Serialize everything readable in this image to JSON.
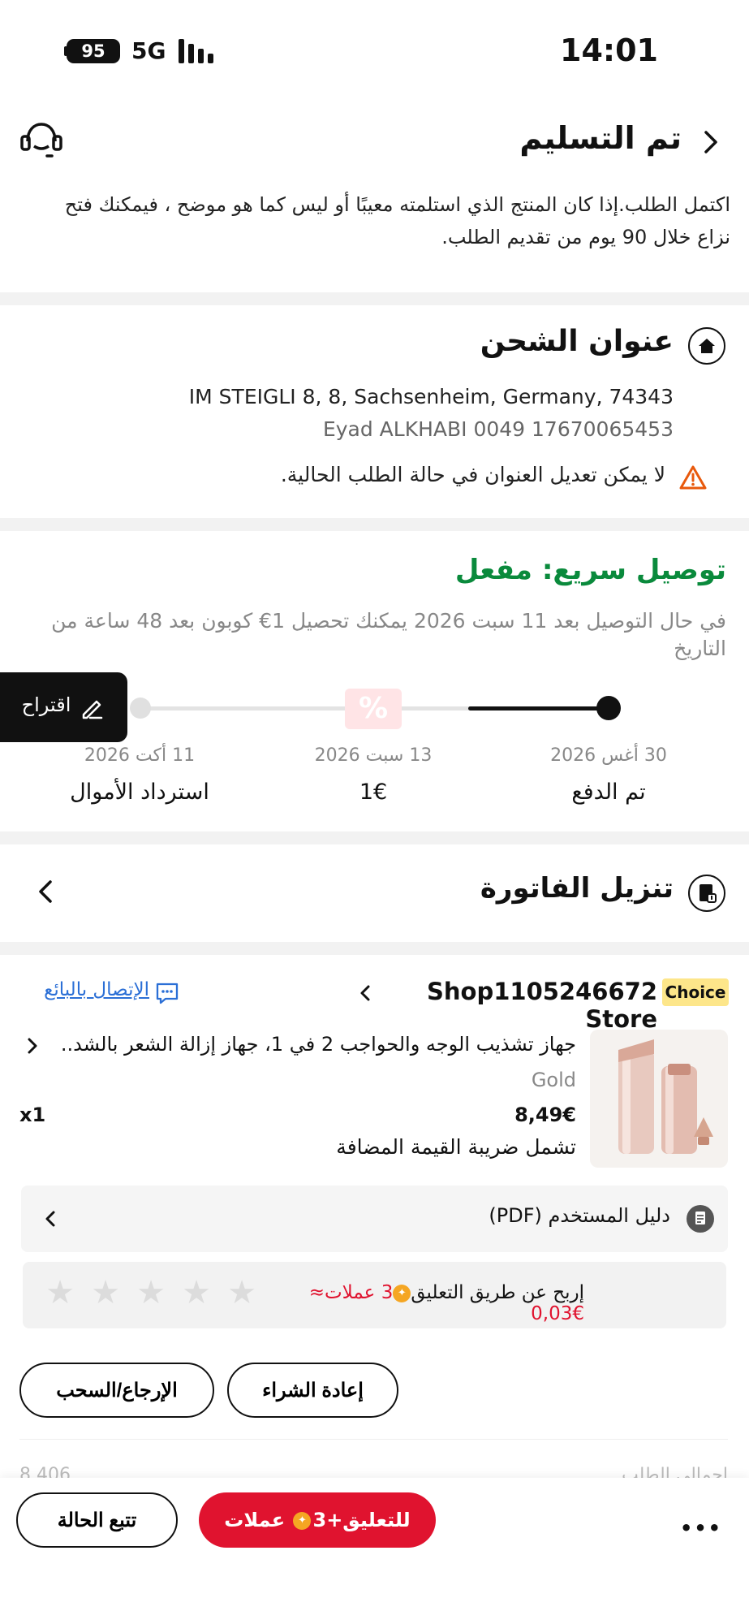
{
  "status_bar": {
    "time": "14:01",
    "battery": "95",
    "network": "5G"
  },
  "header": {
    "title": "تم التسليم"
  },
  "completion_notice": "اكتمل الطلب.إذا كان المنتج الذي استلمته معيبًا أو ليس كما هو موضح ، فيمكنك فتح نزاع خلال 90 يوم من تقديم الطلب.",
  "shipping": {
    "title": "عنوان الشحن",
    "address_line": "IM STEIGLI 8, 8, Sachsenheim, Germany, 74343",
    "contact_line": "Eyad ALKHABI 0049 17670065453",
    "warning": "لا يمكن تعديل العنوان في حالة الطلب الحالية."
  },
  "fast_delivery": {
    "title": "توصيل سريع: مفعل",
    "description": "في حال التوصيل بعد 11 سبت 2026 يمكنك تحصيل 1€ كوبون بعد 48 ساعة من التاريخ",
    "steps": [
      {
        "date": "30 أغس 2026",
        "label": "تم الدفع"
      },
      {
        "date": "13 سبت 2026",
        "label": "1€"
      },
      {
        "date": "11 أكت 2026",
        "label": "استرداد الأموال"
      }
    ],
    "progress": 0.3,
    "suggest_label": "اقتراح"
  },
  "invoice": {
    "title": "تنزيل الفاتورة"
  },
  "store": {
    "badge": "Choice",
    "name": "Shop1105246672 Store",
    "contact_label": "الإتصال بالبائع"
  },
  "product": {
    "title": "جهاز تشذيب الوجه والحواجب 2 في 1، جهاز إزالة الشعر بالشد...",
    "variant": "Gold",
    "price": "8,49€",
    "quantity": "x1",
    "vat_note": "تشمل ضريبة القيمة المضافة"
  },
  "manual": {
    "label": "دليل المستخدم (PDF)"
  },
  "review": {
    "text": "إربح عن طريق التعليق",
    "coins": "3 عملات≈ €0,03",
    "stars": 0,
    "max_stars": 5
  },
  "actions": {
    "rebuy": "إعادة الشراء",
    "return": "الإرجاع/السحب"
  },
  "partial_row": {
    "left": "8,406",
    "right": "إجمالي الطلب"
  },
  "bottom_bar": {
    "track": "تتبع الحالة",
    "review_prefix": "للتعليق+",
    "review_count": "3",
    "review_suffix": " عملات",
    "more": "•••"
  },
  "colors": {
    "brand_red": "#e0132f",
    "green": "#0a8a3c",
    "link_blue": "#2b6fd6",
    "choice_yellow": "#fde68a"
  }
}
